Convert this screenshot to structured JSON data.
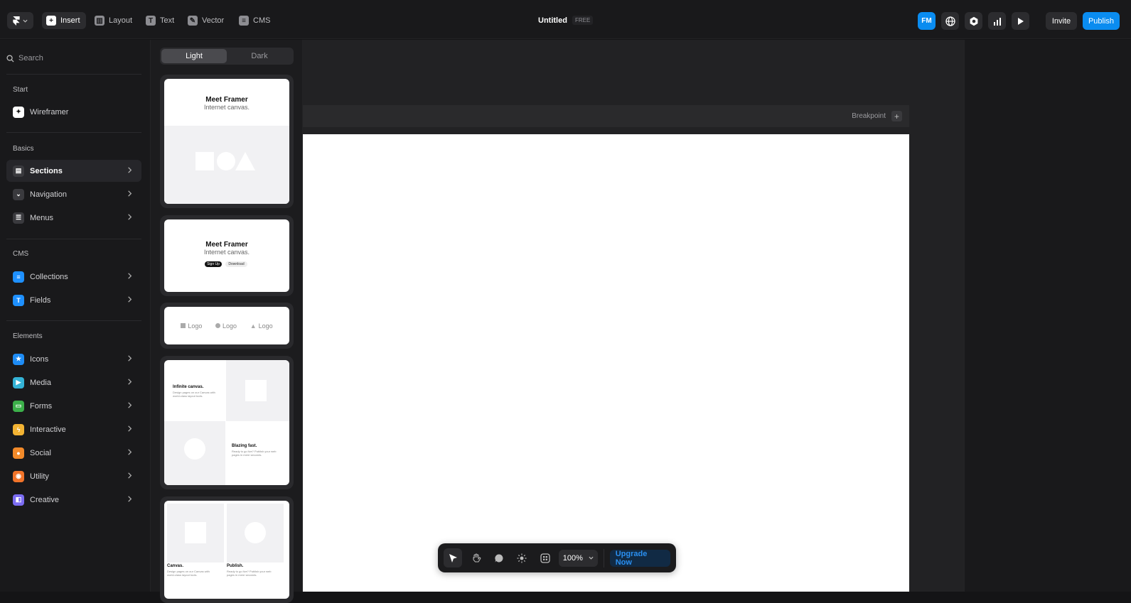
{
  "toolbar": {
    "insert": "Insert",
    "layout": "Layout",
    "text": "Text",
    "vector": "Vector",
    "cms": "CMS",
    "title": "Untitled",
    "badge": "FREE",
    "avatar": "FM",
    "invite": "Invite",
    "publish": "Publish"
  },
  "sidebar": {
    "search_placeholder": "Search",
    "sections": [
      {
        "heading": "Start",
        "items": [
          {
            "label": "Wireframer",
            "color": "#ffffff"
          }
        ]
      },
      {
        "heading": "Basics",
        "items": [
          {
            "label": "Sections",
            "color": "#3a3a3e"
          },
          {
            "label": "Navigation",
            "color": "#3a3a3e"
          },
          {
            "label": "Menus",
            "color": "#3a3a3e"
          }
        ]
      },
      {
        "heading": "CMS",
        "items": [
          {
            "label": "Collections",
            "color": "#1e90ff"
          },
          {
            "label": "Fields",
            "color": "#1e90ff"
          }
        ]
      },
      {
        "heading": "Elements",
        "items": [
          {
            "label": "Icons",
            "color": "#1e8cf5"
          },
          {
            "label": "Media",
            "color": "#34b3d6"
          },
          {
            "label": "Forms",
            "color": "#3cb04a"
          },
          {
            "label": "Interactive",
            "color": "#f2b333"
          },
          {
            "label": "Social",
            "color": "#f28a2a"
          },
          {
            "label": "Utility",
            "color": "#f2742a"
          },
          {
            "label": "Creative",
            "color": "#7b6cf2"
          }
        ]
      }
    ]
  },
  "panel": {
    "toggle_light": "Light",
    "toggle_dark": "Dark",
    "card1": {
      "title": "Meet Framer",
      "subtitle": "Internet canvas."
    },
    "card2": {
      "title": "Meet Framer",
      "subtitle": "Internet canvas.",
      "btn1": "Sign Up",
      "btn2": "Download"
    },
    "card3": {
      "logo": "Logo"
    },
    "card4": {
      "h1": "Infinite canvas.",
      "p1": "Design pages on our Canvas with world-class layout tools.",
      "h2": "Blazing fast.",
      "p2": "Ready to go live? Publish your web pages in mere seconds."
    },
    "card5": {
      "h1": "Canvas.",
      "p1": "Design pages on our Canvas with world-class layout tools.",
      "h2": "Publish.",
      "p2": "Ready to go live? Publish your web pages in mere seconds."
    }
  },
  "canvas": {
    "breakpoint": "Breakpoint"
  },
  "bottombar": {
    "zoom": "100%",
    "upgrade": "Upgrade Now"
  }
}
